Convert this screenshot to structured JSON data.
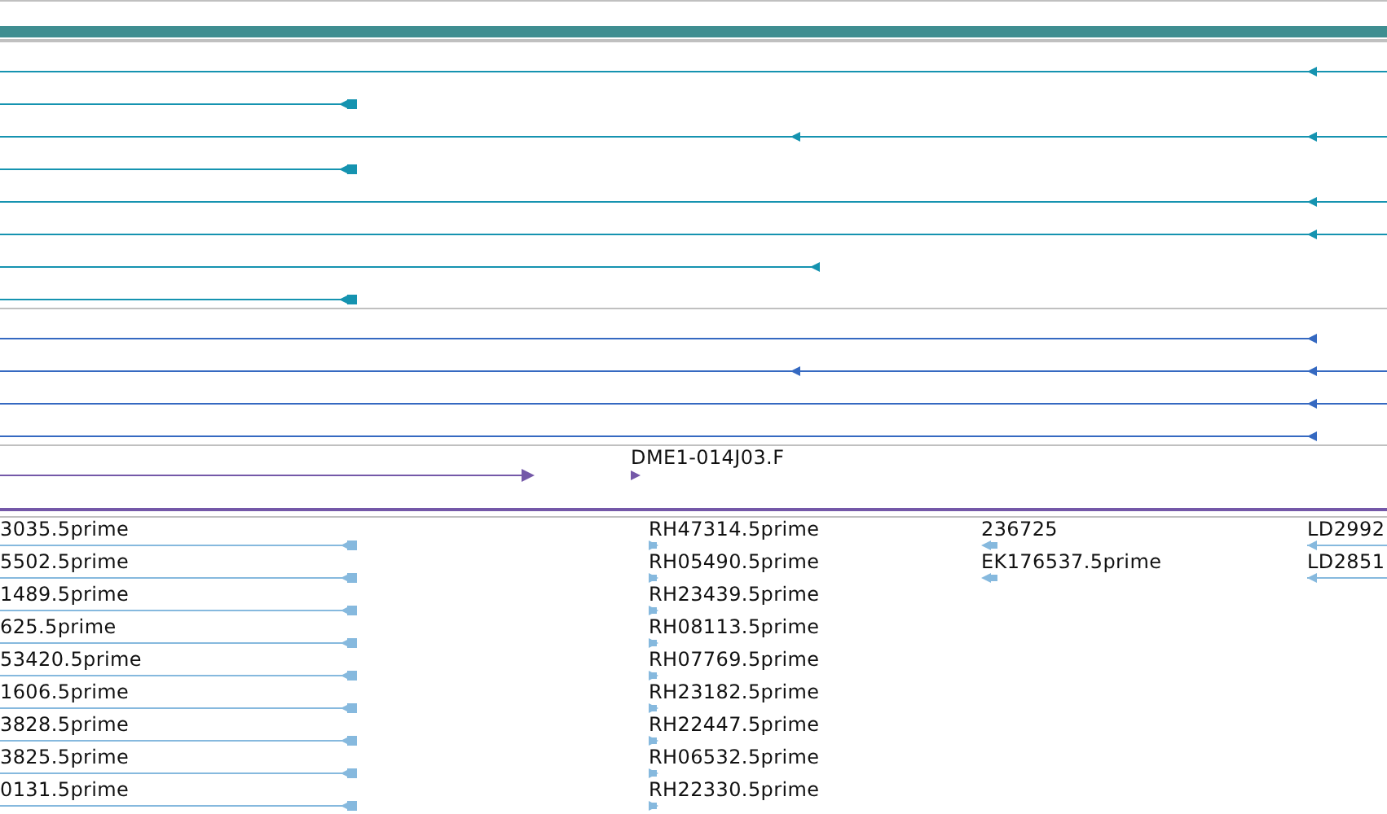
{
  "tracks": [
    {
      "kind": "bar",
      "color": "#3f8e91"
    },
    {
      "kind": "alignments",
      "color": "#1593b0",
      "reverse": true
    },
    {
      "kind": "alignments",
      "color": "#3569c1",
      "reverse": true
    },
    {
      "kind": "clone",
      "color": "#7458a8",
      "features": [
        {
          "label": "DME1-014J03.F",
          "reverse": false
        }
      ]
    },
    {
      "kind": "est",
      "color": "#86b9de",
      "columns": [
        {
          "reverse": true,
          "labels": [
            "3035.5prime",
            "5502.5prime",
            "1489.5prime",
            "625.5prime",
            "53420.5prime",
            "1606.5prime",
            "3828.5prime",
            "3825.5prime",
            "0131.5prime"
          ]
        },
        {
          "reverse": false,
          "labels": [
            "RH47314.5prime",
            "RH05490.5prime",
            "RH23439.5prime",
            "RH08113.5prime",
            "RH07769.5prime",
            "RH23182.5prime",
            "RH22447.5prime",
            "RH06532.5prime",
            "RH22330.5prime"
          ]
        },
        {
          "reverse": true,
          "labels": [
            "236725",
            "EK176537.5prime"
          ]
        },
        {
          "reverse": true,
          "labels": [
            "LD2992",
            "LD2851"
          ]
        }
      ]
    }
  ]
}
